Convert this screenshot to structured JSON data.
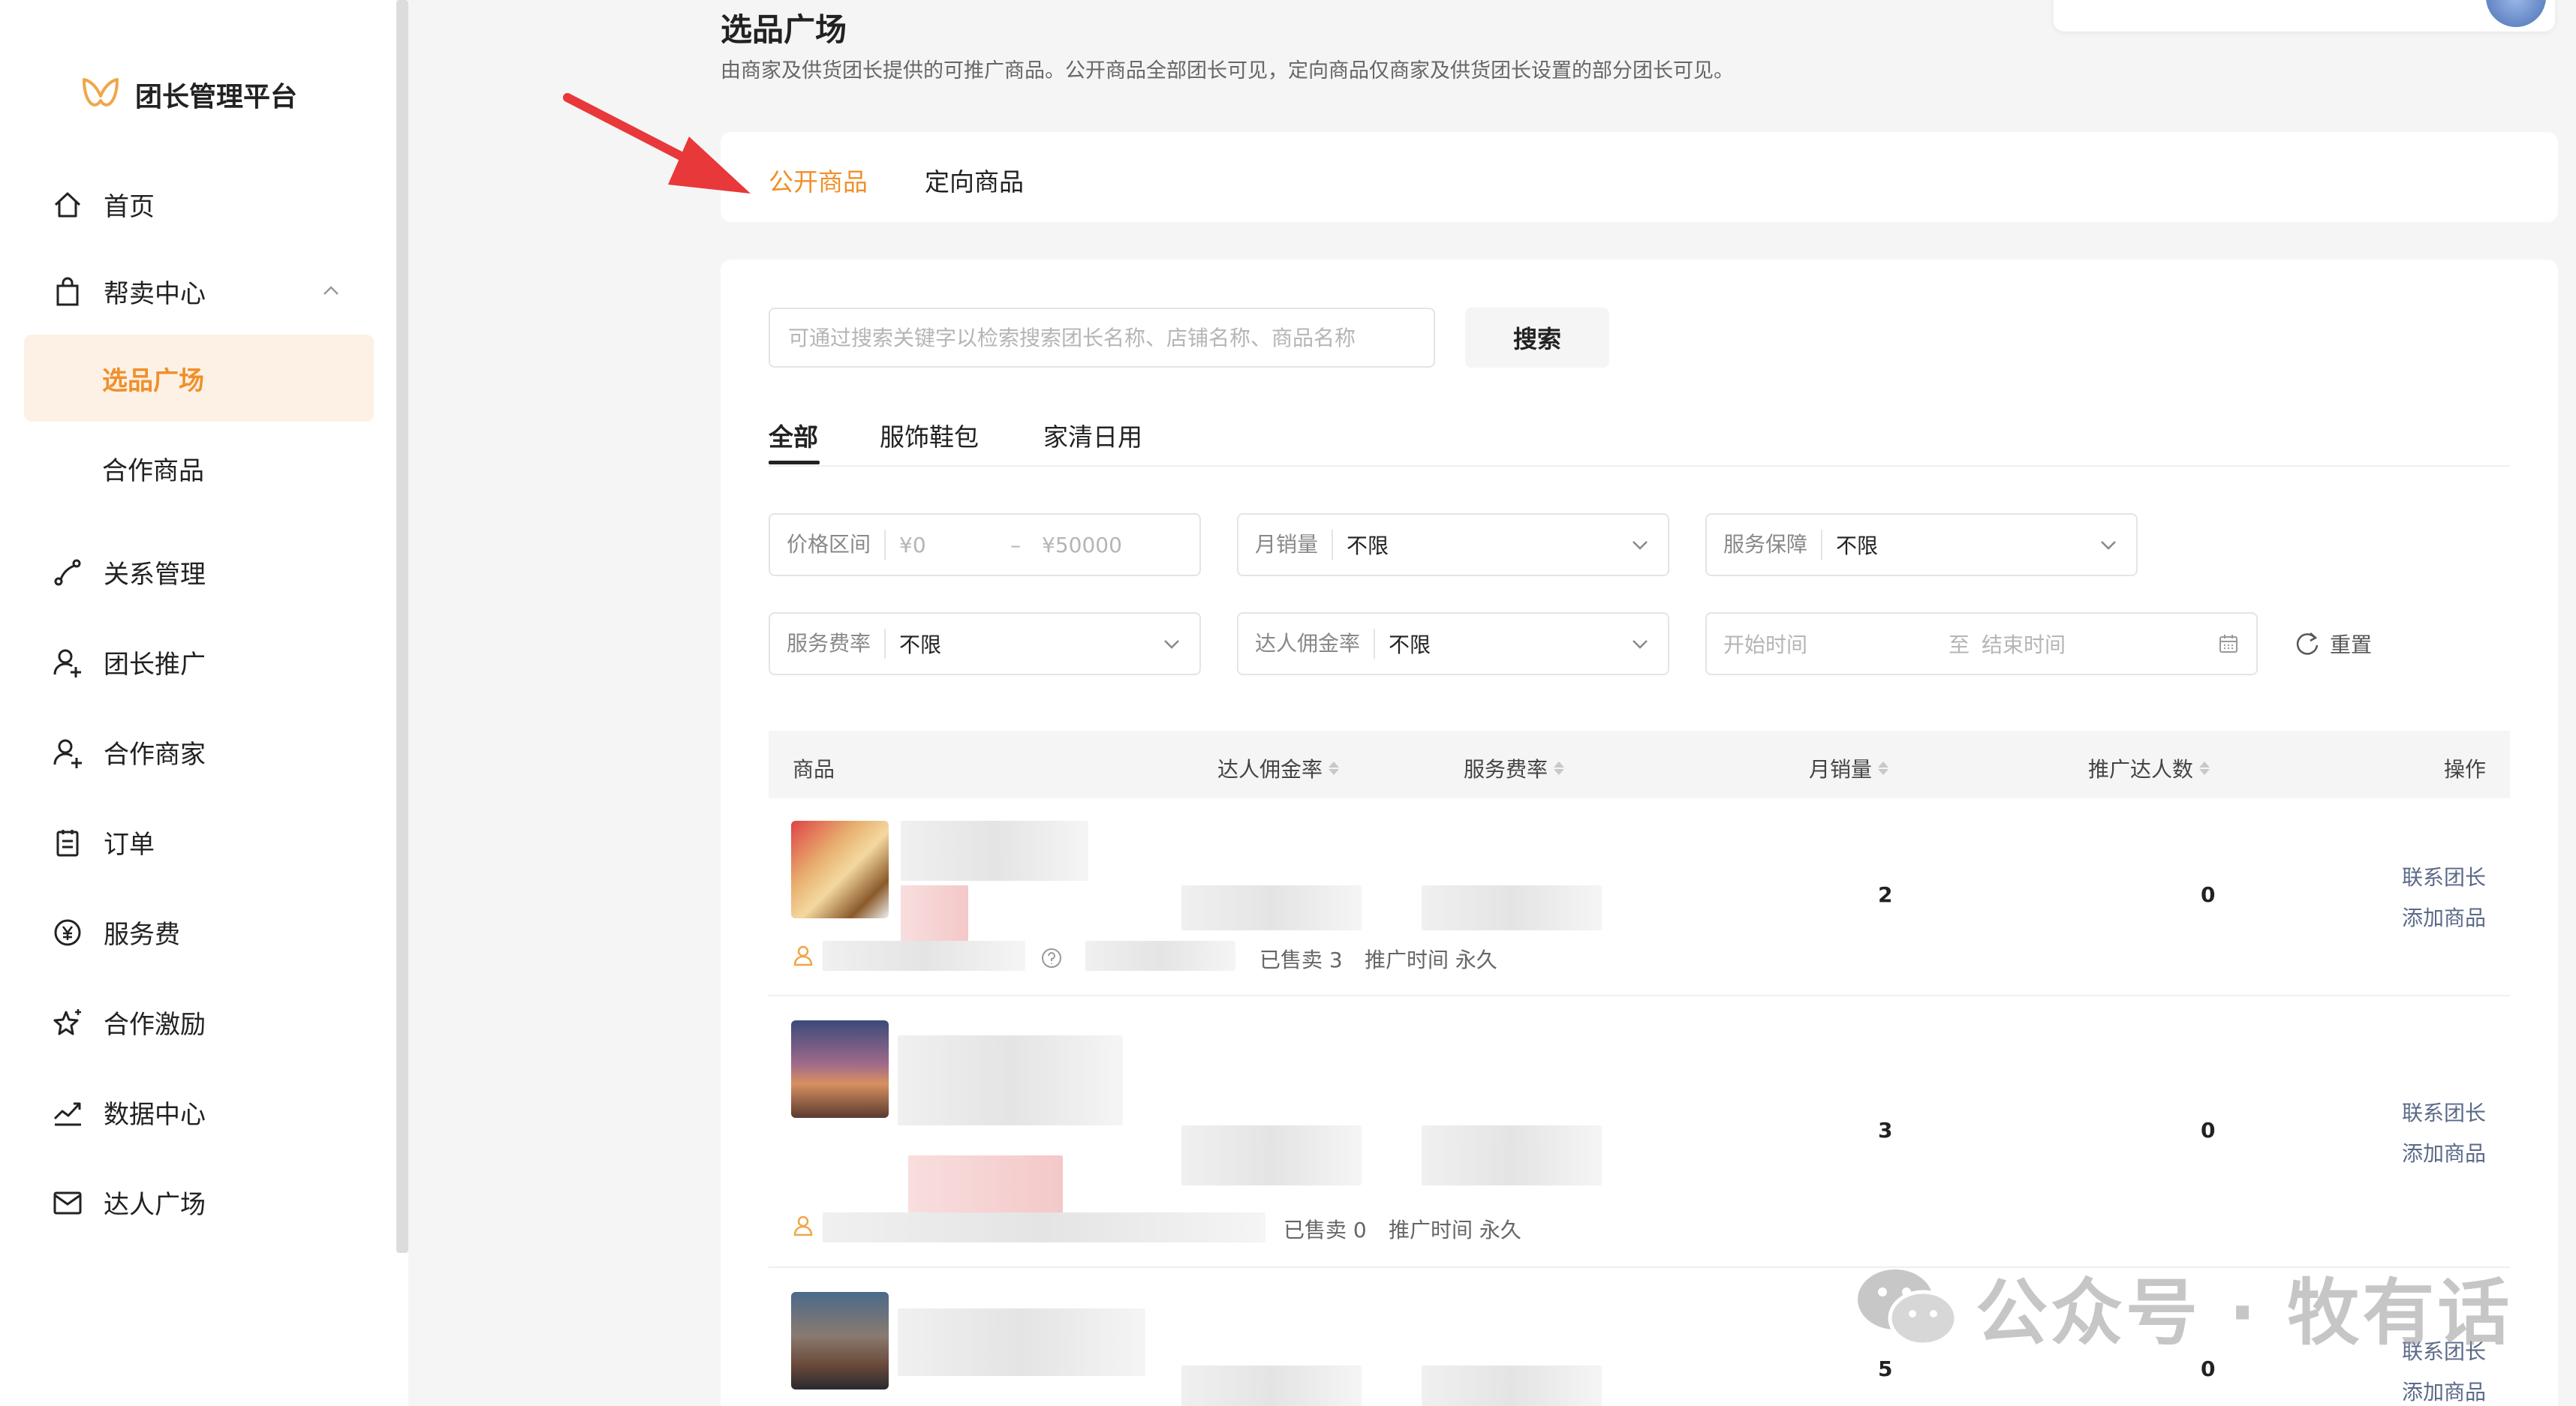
{
  "sidebar": {
    "logo_text": "团长管理平台",
    "items": {
      "home": "首页",
      "sales_center": "帮卖中心",
      "selection_plaza": "选品广场",
      "coop_products": "合作商品",
      "relations": "关系管理",
      "leader_promo": "团长推广",
      "coop_merchants": "合作商家",
      "orders": "订单",
      "service_fee": "服务费",
      "coop_incentive": "合作激励",
      "data_center": "数据中心",
      "talent_plaza": "达人广场"
    }
  },
  "page": {
    "title": "选品广场",
    "description": "由商家及供货团长提供的可推广商品。公开商品全部团长可见，定向商品仅商家及供货团长设置的部分团长可见。"
  },
  "top_tabs": [
    "公开商品",
    "定向商品"
  ],
  "search": {
    "placeholder": "可通过搜索关键字以检索搜索团长名称、店铺名称、商品名称",
    "button": "搜索"
  },
  "category_tabs": [
    "全部",
    "服饰鞋包",
    "家清日用"
  ],
  "filters": {
    "price_label": "价格区间",
    "price_min_ph": "¥0",
    "price_sep": "–",
    "price_max_ph": "¥50000",
    "monthly_sales_label": "月销量",
    "monthly_sales_value": "不限",
    "service_guarantee_label": "服务保障",
    "service_guarantee_value": "不限",
    "service_rate_label": "服务费率",
    "service_rate_value": "不限",
    "commission_label": "达人佣金率",
    "commission_value": "不限",
    "start_time_ph": "开始时间",
    "to": "至",
    "end_time_ph": "结束时间",
    "reset": "重置"
  },
  "table": {
    "headers": {
      "product": "商品",
      "commission": "达人佣金率",
      "service_rate": "服务费率",
      "monthly_sales": "月销量",
      "promoters": "推广达人数",
      "actions": "操作"
    },
    "rows": [
      {
        "sold": "已售卖 3",
        "promo_time": "推广时间 永久",
        "monthly_sales": "2",
        "promoters": "0",
        "contact": "联系团长",
        "add": "添加商品"
      },
      {
        "sold": "已售卖 0",
        "promo_time": "推广时间 永久",
        "monthly_sales": "3",
        "promoters": "0",
        "contact": "联系团长",
        "add": "添加商品"
      },
      {
        "monthly_sales": "5",
        "promoters": "0",
        "contact": "联系团长",
        "add": "添加商品"
      }
    ]
  },
  "watermark": "公众号 · 牧有话",
  "colors": {
    "accent": "#f0902a",
    "active_bg": "#fdf1e6",
    "link": "#5a6a88",
    "arrow": "#e8383a"
  }
}
